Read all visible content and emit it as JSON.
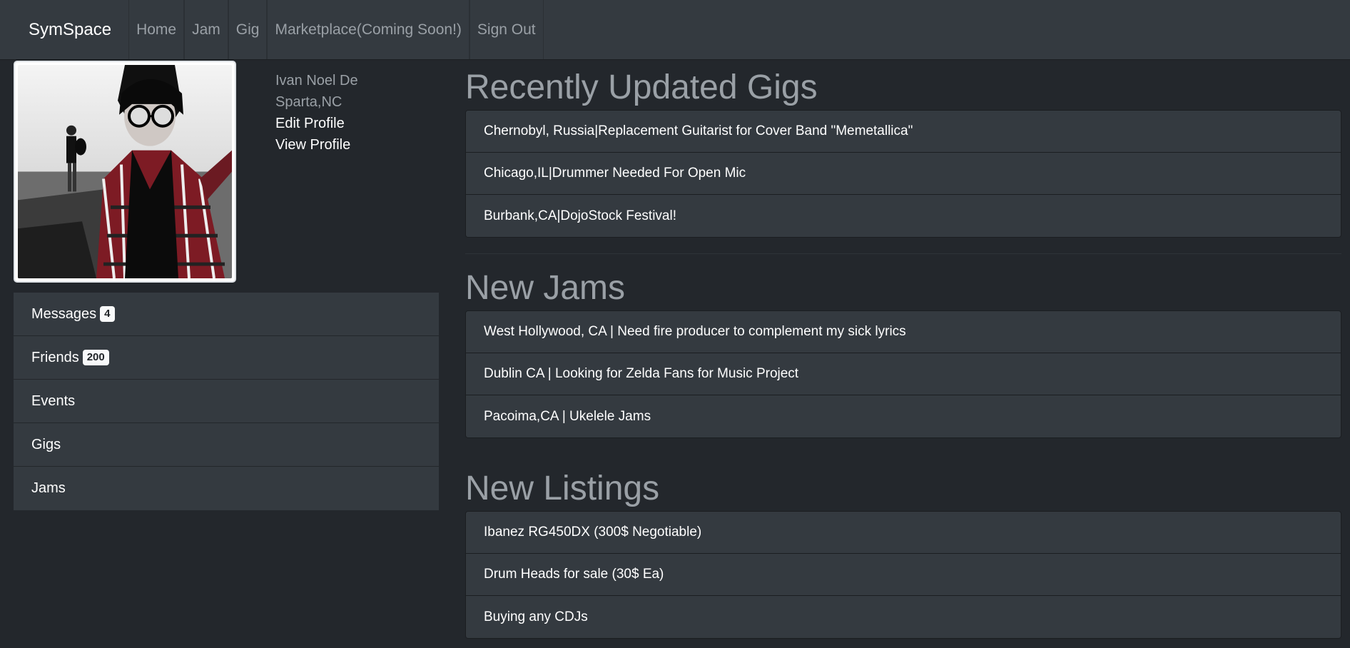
{
  "navbar": {
    "brand": "SymSpace",
    "links": [
      "Home",
      "Jam",
      "Gig",
      "Marketplace(Coming Soon!)",
      "Sign Out"
    ]
  },
  "profile": {
    "name": "Ivan Noel De",
    "location": "Sparta,NC",
    "edit_label": "Edit Profile",
    "view_label": "View Profile"
  },
  "sidebar": {
    "items": [
      {
        "label": "Messages",
        "badge": "4"
      },
      {
        "label": "Friends",
        "badge": "200"
      },
      {
        "label": "Events"
      },
      {
        "label": "Gigs"
      },
      {
        "label": "Jams"
      }
    ]
  },
  "gigs": {
    "title": "Recently Updated Gigs",
    "items": [
      "Chernobyl, Russia|Replacement Guitarist for Cover Band \"Memetallica\"",
      "Chicago,IL|Drummer Needed For Open Mic",
      "Burbank,CA|DojoStock Festival!"
    ]
  },
  "jams": {
    "title": "New Jams",
    "items": [
      "West Hollywood, CA | Need fire producer to complement my sick lyrics",
      "Dublin CA | Looking for Zelda Fans for Music Project",
      "Pacoima,CA | Ukelele Jams"
    ]
  },
  "listings": {
    "title": "New Listings",
    "items": [
      "Ibanez RG450DX (300$ Negotiable)",
      "Drum Heads for sale (30$ Ea)",
      "Buying any CDJs"
    ]
  },
  "colors": {
    "background": "#23272c",
    "navbar": "#343a40",
    "muted_text": "#9aa0a6"
  }
}
